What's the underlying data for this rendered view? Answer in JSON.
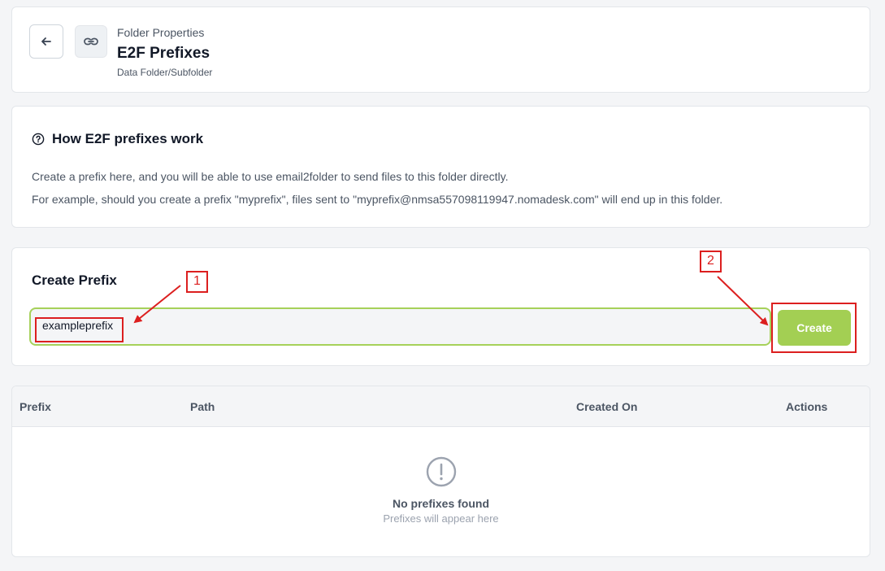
{
  "header": {
    "eyebrow": "Folder Properties",
    "title": "E2F Prefixes",
    "subtitle": "Data Folder/Subfolder",
    "back_icon": "arrow-left-icon",
    "link_icon": "link-icon"
  },
  "info": {
    "title": "How E2F prefixes work",
    "icon": "question-circle-icon",
    "line1": "Create a prefix here, and you will be able to use email2folder to send files to this folder directly.",
    "line2": "For example, should you create a prefix \"myprefix\", files sent to \"myprefix@nmsa557098119947.nomadesk.com\" will end up in this folder."
  },
  "create": {
    "title": "Create Prefix",
    "input_value": "exampleprefix",
    "button_label": "Create"
  },
  "table": {
    "columns": [
      "Prefix",
      "Path",
      "Created On",
      "Actions"
    ],
    "rows": [],
    "empty_title": "No prefixes found",
    "empty_subtitle": "Prefixes will appear here",
    "empty_icon": "exclamation-circle-icon"
  },
  "annotations": {
    "label1": "1",
    "label2": "2"
  },
  "colors": {
    "accent_green": "#a3cf53",
    "input_border": "#a6d15a",
    "annotation_red": "#dc1f1f"
  }
}
